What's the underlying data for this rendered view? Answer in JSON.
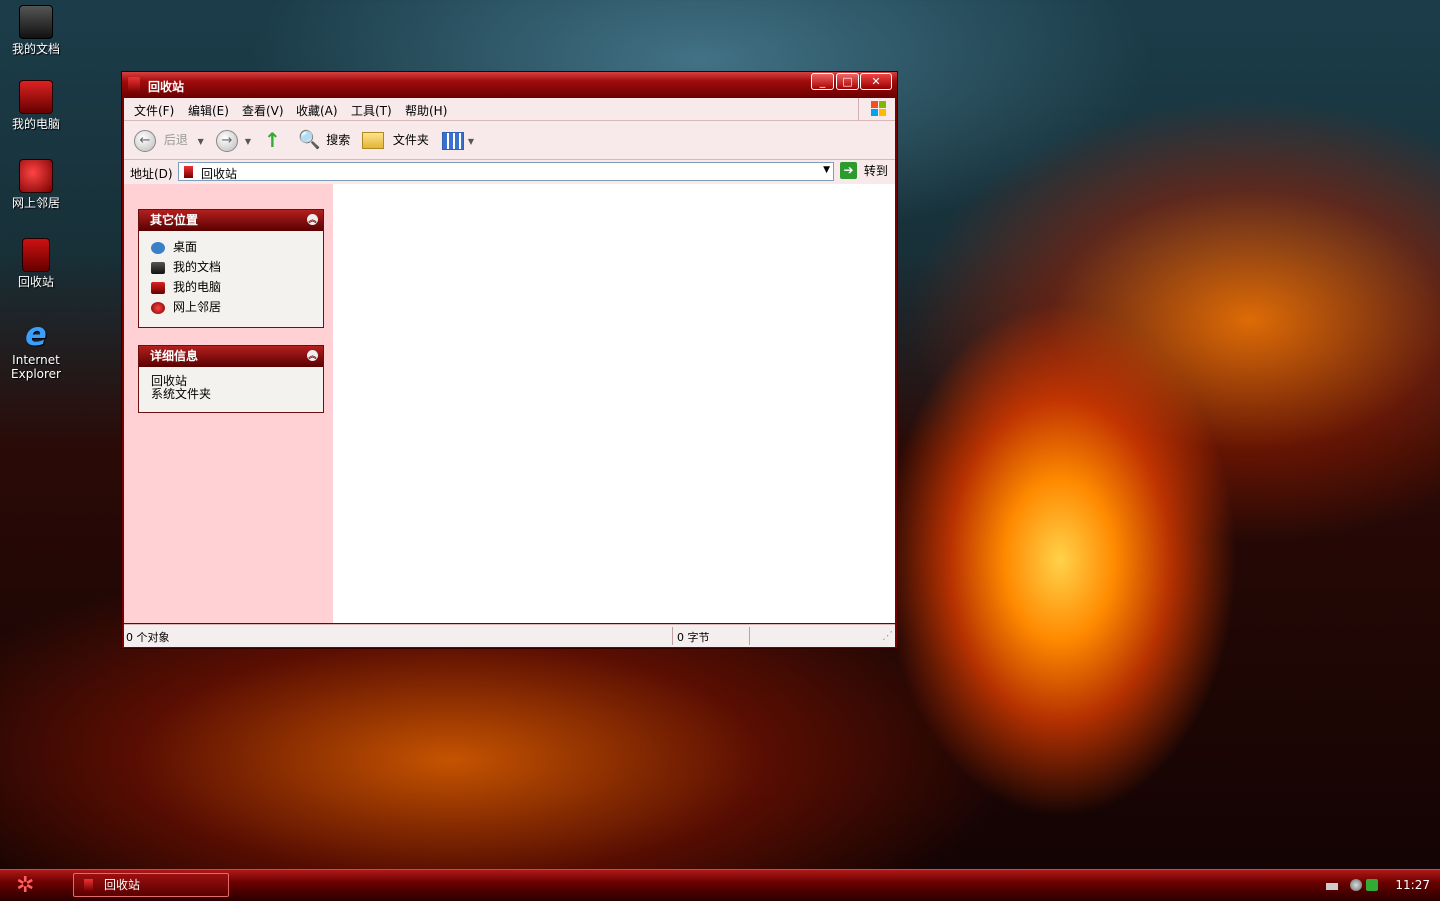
{
  "desktop": {
    "icons": [
      {
        "label": "我的文档",
        "icon": "my-documents-icon"
      },
      {
        "label": "我的电脑",
        "icon": "my-computer-icon"
      },
      {
        "label": "网上邻居",
        "icon": "network-places-icon"
      },
      {
        "label": "回收站",
        "icon": "recycle-bin-icon"
      },
      {
        "label": "Internet Explorer",
        "icon": "internet-explorer-icon"
      }
    ]
  },
  "window": {
    "title": "回收站",
    "buttons": {
      "minimize": "_",
      "maximize": "□",
      "close": "✕"
    },
    "menu": [
      "文件(F)",
      "编辑(E)",
      "查看(V)",
      "收藏(A)",
      "工具(T)",
      "帮助(H)"
    ],
    "toolbar": {
      "back": "后退",
      "search": "搜索",
      "folders": "文件夹"
    },
    "address": {
      "label": "地址(D)",
      "value": "回收站",
      "go": "转到"
    },
    "other_places": {
      "title": "其它位置",
      "items": [
        "桌面",
        "我的文档",
        "我的电脑",
        "网上邻居"
      ]
    },
    "details": {
      "title": "详细信息",
      "name": "回收站",
      "type": "系统文件夹"
    },
    "status": {
      "objects": "0 个对象",
      "size": "0 字节"
    }
  },
  "taskbar": {
    "task": "回收站",
    "clock": "11:27"
  },
  "colors": {
    "accent": "#a00c0c",
    "pane": "#ffd0d4"
  }
}
